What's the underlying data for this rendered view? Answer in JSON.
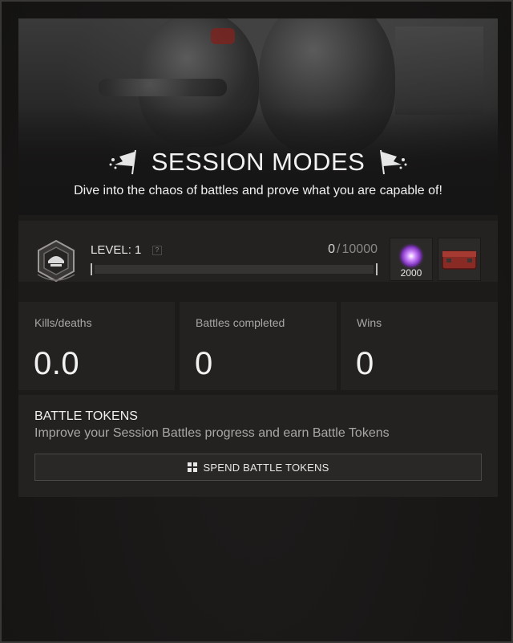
{
  "hero": {
    "title": "SESSION MODES",
    "subtitle": "Dive into the chaos of battles and prove what you are capable of!"
  },
  "level": {
    "label": "LEVEL: 1",
    "help": "?",
    "xp_current": "0",
    "xp_separator": "/",
    "xp_max": "10000",
    "progress_fraction": 0.0,
    "rewards": [
      {
        "icon": "purple-orb-icon",
        "count": "2000"
      },
      {
        "icon": "red-crate-icon",
        "count": ""
      }
    ]
  },
  "stats": [
    {
      "label": "Kills/deaths",
      "value": "0.0"
    },
    {
      "label": "Battles completed",
      "value": "0"
    },
    {
      "label": "Wins",
      "value": "0"
    }
  ],
  "tokens": {
    "title": "BATTLE TOKENS",
    "description": "Improve your Session Battles progress and earn Battle Tokens",
    "button_label": "SPEND BATTLE TOKENS"
  },
  "colors": {
    "background": "#1a1817",
    "card": "#242221",
    "text_primary": "#f0f0f0",
    "text_muted": "#a9a7a5",
    "reward_orb": "#b25cf2",
    "reward_crate": "#8a2a24"
  }
}
